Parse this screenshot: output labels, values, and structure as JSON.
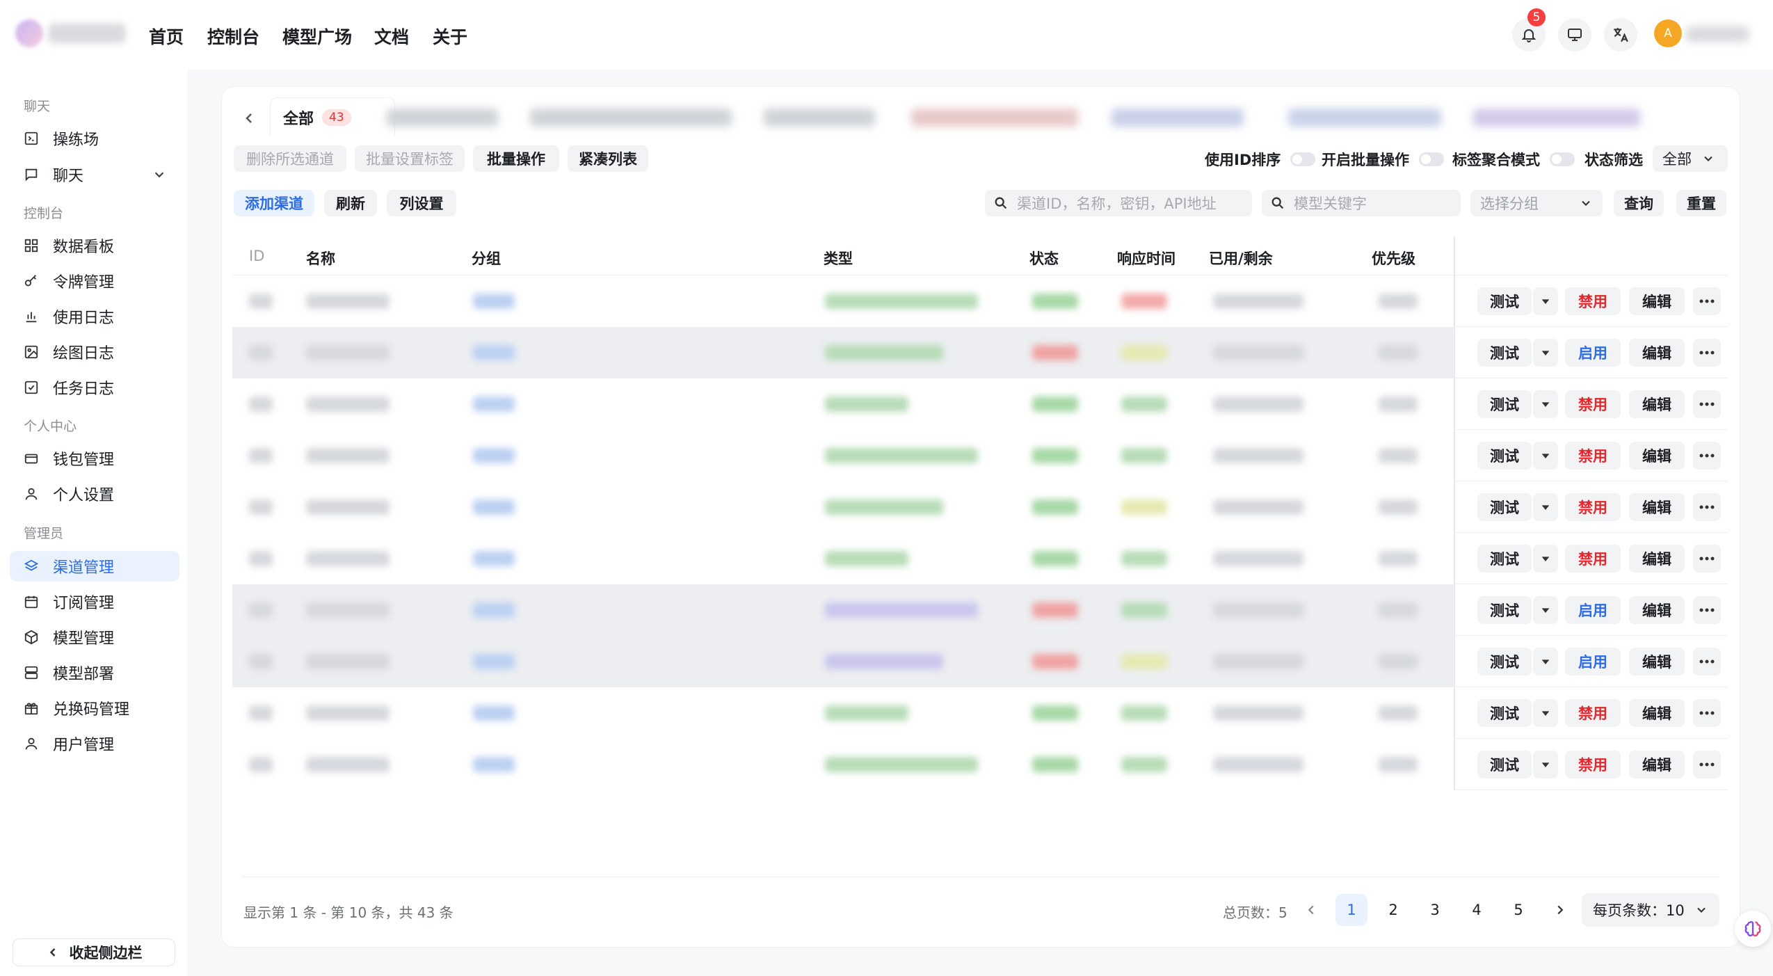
{
  "header": {
    "nav": [
      "首页",
      "控制台",
      "模型广场",
      "文档",
      "关于"
    ],
    "notification_count": "5",
    "avatar_letter": "A"
  },
  "sidebar": {
    "sections": [
      {
        "title": "聊天",
        "items": [
          {
            "label": "操练场",
            "icon": "playground-icon"
          },
          {
            "label": "聊天",
            "icon": "chat-icon"
          }
        ]
      },
      {
        "title": "控制台",
        "items": [
          {
            "label": "数据看板",
            "icon": "dashboard-icon"
          },
          {
            "label": "令牌管理",
            "icon": "key-icon"
          },
          {
            "label": "使用日志",
            "icon": "bar-chart-icon"
          },
          {
            "label": "绘图日志",
            "icon": "image-icon"
          },
          {
            "label": "任务日志",
            "icon": "checklist-icon"
          }
        ]
      },
      {
        "title": "个人中心",
        "items": [
          {
            "label": "钱包管理",
            "icon": "wallet-icon"
          },
          {
            "label": "个人设置",
            "icon": "user-icon"
          }
        ]
      },
      {
        "title": "管理员",
        "items": [
          {
            "label": "渠道管理",
            "icon": "layers-icon"
          },
          {
            "label": "订阅管理",
            "icon": "calendar-icon"
          },
          {
            "label": "模型管理",
            "icon": "cube-icon"
          },
          {
            "label": "模型部署",
            "icon": "server-icon"
          },
          {
            "label": "兑换码管理",
            "icon": "gift-icon"
          },
          {
            "label": "用户管理",
            "icon": "user-icon"
          }
        ]
      }
    ],
    "active_item": "渠道管理",
    "collapse_label": "收起侧边栏"
  },
  "tabs": {
    "all_label": "全部",
    "all_count": "43"
  },
  "toolbar": {
    "delete_selected": "删除所选通道",
    "batch_tag": "批量设置标签",
    "batch_ops": "批量操作",
    "compact_list": "紧凑列表",
    "sort_by_id": "使用ID排序",
    "enable_batch": "开启批量操作",
    "tag_aggregate": "标签聚合模式",
    "status_filter": "状态筛选",
    "status_value": "全部",
    "add_channel": "添加渠道",
    "refresh": "刷新",
    "column_settings": "列设置",
    "search_placeholder": "渠道ID，名称，密钥，API地址",
    "model_placeholder": "模型关键字",
    "group_placeholder": "选择分组",
    "query": "查询",
    "reset": "重置"
  },
  "table": {
    "headers": [
      "ID",
      "名称",
      "分组",
      "类型",
      "状态",
      "响应时间",
      "已用/剩余",
      "优先级"
    ],
    "rows": [
      {
        "toggle": "禁用",
        "state": "enabled"
      },
      {
        "toggle": "启用",
        "state": "disabled"
      },
      {
        "toggle": "禁用",
        "state": "enabled"
      },
      {
        "toggle": "禁用",
        "state": "enabled"
      },
      {
        "toggle": "禁用",
        "state": "enabled"
      },
      {
        "toggle": "禁用",
        "state": "enabled"
      },
      {
        "toggle": "启用",
        "state": "disabled"
      },
      {
        "toggle": "启用",
        "state": "disabled"
      },
      {
        "toggle": "禁用",
        "state": "enabled"
      },
      {
        "toggle": "禁用",
        "state": "enabled"
      }
    ],
    "test_label": "测试",
    "edit_label": "编辑",
    "colors": {
      "disable": "#e5272d",
      "enable": "#2e6be6"
    }
  },
  "footer": {
    "summary": "显示第 1 条 - 第 10 条，共 43 条",
    "total_pages": "总页数：5",
    "pages": [
      "1",
      "2",
      "3",
      "4",
      "5"
    ],
    "current_page": "1",
    "page_size": "每页条数：10"
  }
}
